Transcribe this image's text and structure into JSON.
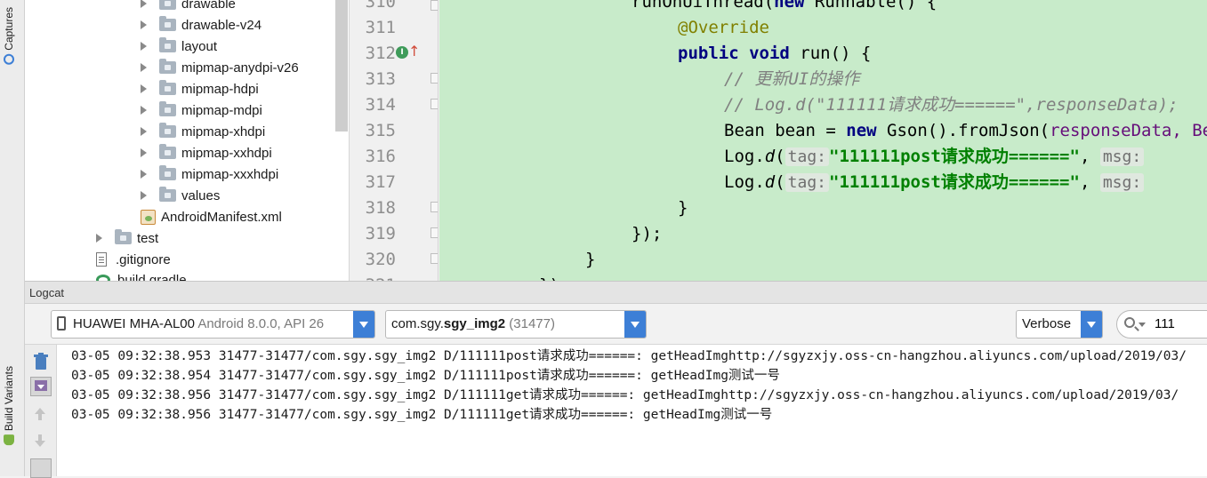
{
  "side_tabs": {
    "captures": "Captures",
    "build_variants": "Build Variants"
  },
  "tree": {
    "items": [
      {
        "label": "drawable",
        "kind": "folder"
      },
      {
        "label": "drawable-v24",
        "kind": "folder"
      },
      {
        "label": "layout",
        "kind": "folder"
      },
      {
        "label": "mipmap-anydpi-v26",
        "kind": "folder"
      },
      {
        "label": "mipmap-hdpi",
        "kind": "folder"
      },
      {
        "label": "mipmap-mdpi",
        "kind": "folder"
      },
      {
        "label": "mipmap-xhdpi",
        "kind": "folder"
      },
      {
        "label": "mipmap-xxhdpi",
        "kind": "folder"
      },
      {
        "label": "mipmap-xxxhdpi",
        "kind": "folder"
      },
      {
        "label": "values",
        "kind": "folder"
      },
      {
        "label": "AndroidManifest.xml",
        "kind": "xml"
      },
      {
        "label": "test",
        "kind": "folder"
      },
      {
        "label": ".gitignore",
        "kind": "file"
      },
      {
        "label": "build.gradle",
        "kind": "gradle"
      }
    ]
  },
  "editor": {
    "line_numbers": [
      "310",
      "311",
      "312",
      "313",
      "314",
      "315",
      "316",
      "317",
      "318",
      "319",
      "320",
      "321"
    ],
    "code": {
      "l310_a": "runOnUiThread(",
      "l310_kw": "new",
      "l310_b": " Runnable() {",
      "l311": "@Override",
      "l312_kw1": "public",
      "l312_kw2": "void",
      "l312_b": " run() {",
      "l313": "// 更新UI的操作",
      "l314": "// Log.d(\"111111请求成功======\",responseData);",
      "l315_a": "Bean bean = ",
      "l315_kw": "new",
      "l315_b": " Gson().fromJson(",
      "l315_c": "responseData, Bean.class);",
      "l316_a": "Log.",
      "l316_fn": "d",
      "l316_b": "(",
      "l316_hint": "tag:",
      "l316_str": "\"111111post请求成功======\"",
      "l316_c": ", ",
      "l316_hint2": "msg:",
      "l317_a": "Log.",
      "l317_fn": "d",
      "l317_b": "(",
      "l317_hint": "tag:",
      "l317_str": "\"111111post请求成功======\"",
      "l317_c": ", ",
      "l317_hint2": "msg:",
      "l318": "}",
      "l319": "});",
      "l320": "}",
      "l321": "});"
    }
  },
  "logcat": {
    "title": "Logcat",
    "device": "HUAWEI MHA-AL00",
    "device_detail": "Android 8.0.0, API 26",
    "package_prefix": "com.sgy.",
    "package_bold": "sgy_img2",
    "package_pid": "(31477)",
    "level": "Verbose",
    "search_value": "111",
    "lines": [
      "03-05 09:32:38.953 31477-31477/com.sgy.sgy_img2 D/111111post请求成功======: getHeadImghttp://sgyzxjy.oss-cn-hangzhou.aliyuncs.com/upload/2019/03/",
      "03-05 09:32:38.954 31477-31477/com.sgy.sgy_img2 D/111111post请求成功======: getHeadImg测试一号",
      "03-05 09:32:38.956 31477-31477/com.sgy.sgy_img2 D/111111get请求成功======: getHeadImghttp://sgyzxjy.oss-cn-hangzhou.aliyuncs.com/upload/2019/03/",
      "03-05 09:32:38.956 31477-31477/com.sgy.sgy_img2 D/111111get请求成功======: getHeadImg测试一号"
    ]
  },
  "colors": {
    "editor_bg": "#c8ebca",
    "keyword": "#000080",
    "string": "#008000",
    "annotation": "#808000",
    "comment": "#808080",
    "accent": "#3d7fd6"
  }
}
